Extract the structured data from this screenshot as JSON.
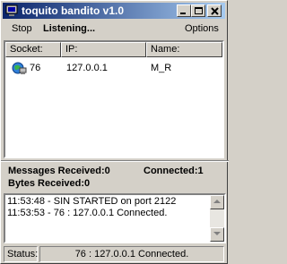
{
  "window": {
    "title": "toquito bandito v1.0"
  },
  "menu": {
    "stop": "Stop",
    "state": "Listening...",
    "options": "Options"
  },
  "connections": {
    "columns": [
      "Socket:",
      "IP:",
      "Name:"
    ],
    "rows": [
      {
        "socket": "76",
        "ip": "127.0.0.1",
        "name": "M_R"
      }
    ]
  },
  "stats": {
    "messages_label": "Messages Received:",
    "messages_value": "0",
    "connected_label": "Connected:",
    "connected_value": "1",
    "bytes_label": "Bytes Received:",
    "bytes_value": "0"
  },
  "log": [
    "11:53:48 - SIN STARTED on port 2122",
    "11:53:53 - 76 : 127.0.0.1 Connected."
  ],
  "status": {
    "label": "Status:",
    "text": "76 : 127.0.0.1 Connected."
  },
  "colors": {
    "title_start": "#0a246a",
    "title_end": "#a6caf0",
    "face": "#d4d0c8"
  },
  "icons": {
    "app": "computer-icon",
    "row": "network-computer-icon"
  }
}
